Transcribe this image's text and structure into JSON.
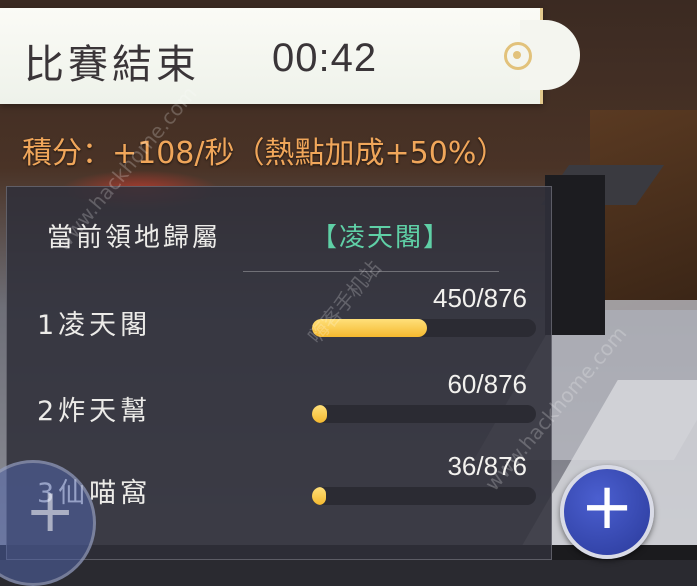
{
  "header": {
    "title": "比賽結束",
    "timer": "00:42"
  },
  "score": {
    "text": "積分：+108/秒（熱點加成+50%）"
  },
  "territory": {
    "label": "當前領地歸屬",
    "owner": "【凌天閣】",
    "rows": [
      {
        "rank_name": "1凌天閣",
        "value": "450/876",
        "progress": 0.514
      },
      {
        "rank_name": "2炸天幫",
        "value": "60/876",
        "progress": 0.068
      },
      {
        "rank_name": "3仙喵窩",
        "value": "36/876",
        "progress": 0.041
      }
    ]
  },
  "buttons": {
    "plus_glyph": "+"
  },
  "watermark": {
    "text_1": "www.hackhome.com",
    "text_2": "嗨客手机站",
    "text_3": "www.hackhome.com"
  },
  "colors": {
    "score": "#f0a65a",
    "owner": "#5fd0a6",
    "bar_fill": "#f5b92f",
    "panel_bg": "#30303a"
  },
  "icons": {
    "banner_ornament": "ring-ornament-icon",
    "add": "plus-icon"
  }
}
